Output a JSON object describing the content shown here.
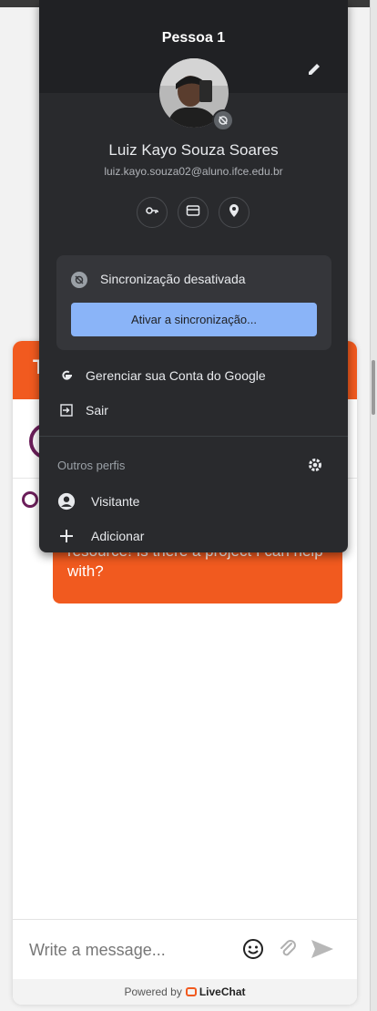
{
  "popup": {
    "profile_name": "Pessoa 1",
    "full_name": "Luiz Kayo Souza Soares",
    "email": "luiz.kayo.souza02@aluno.ifce.edu.br",
    "sync": {
      "status": "Sincronização desativada",
      "button": "Ativar a sincronização..."
    },
    "menu": {
      "manage_account": "Gerenciar sua Conta do Google",
      "sign_out": "Sair"
    },
    "other_profiles": {
      "title": "Outros perfis",
      "items": [
        {
          "label": "Visitante",
          "icon": "person-icon"
        },
        {
          "label": "Adicionar",
          "icon": "plus-icon"
        }
      ]
    }
  },
  "chat": {
    "bubble_text": "resource! Is there a project I can help with?",
    "input_placeholder": "Write a message...",
    "powered_by": "Powered by",
    "brand": "LiveChat",
    "accent_color": "#f15a1f"
  }
}
